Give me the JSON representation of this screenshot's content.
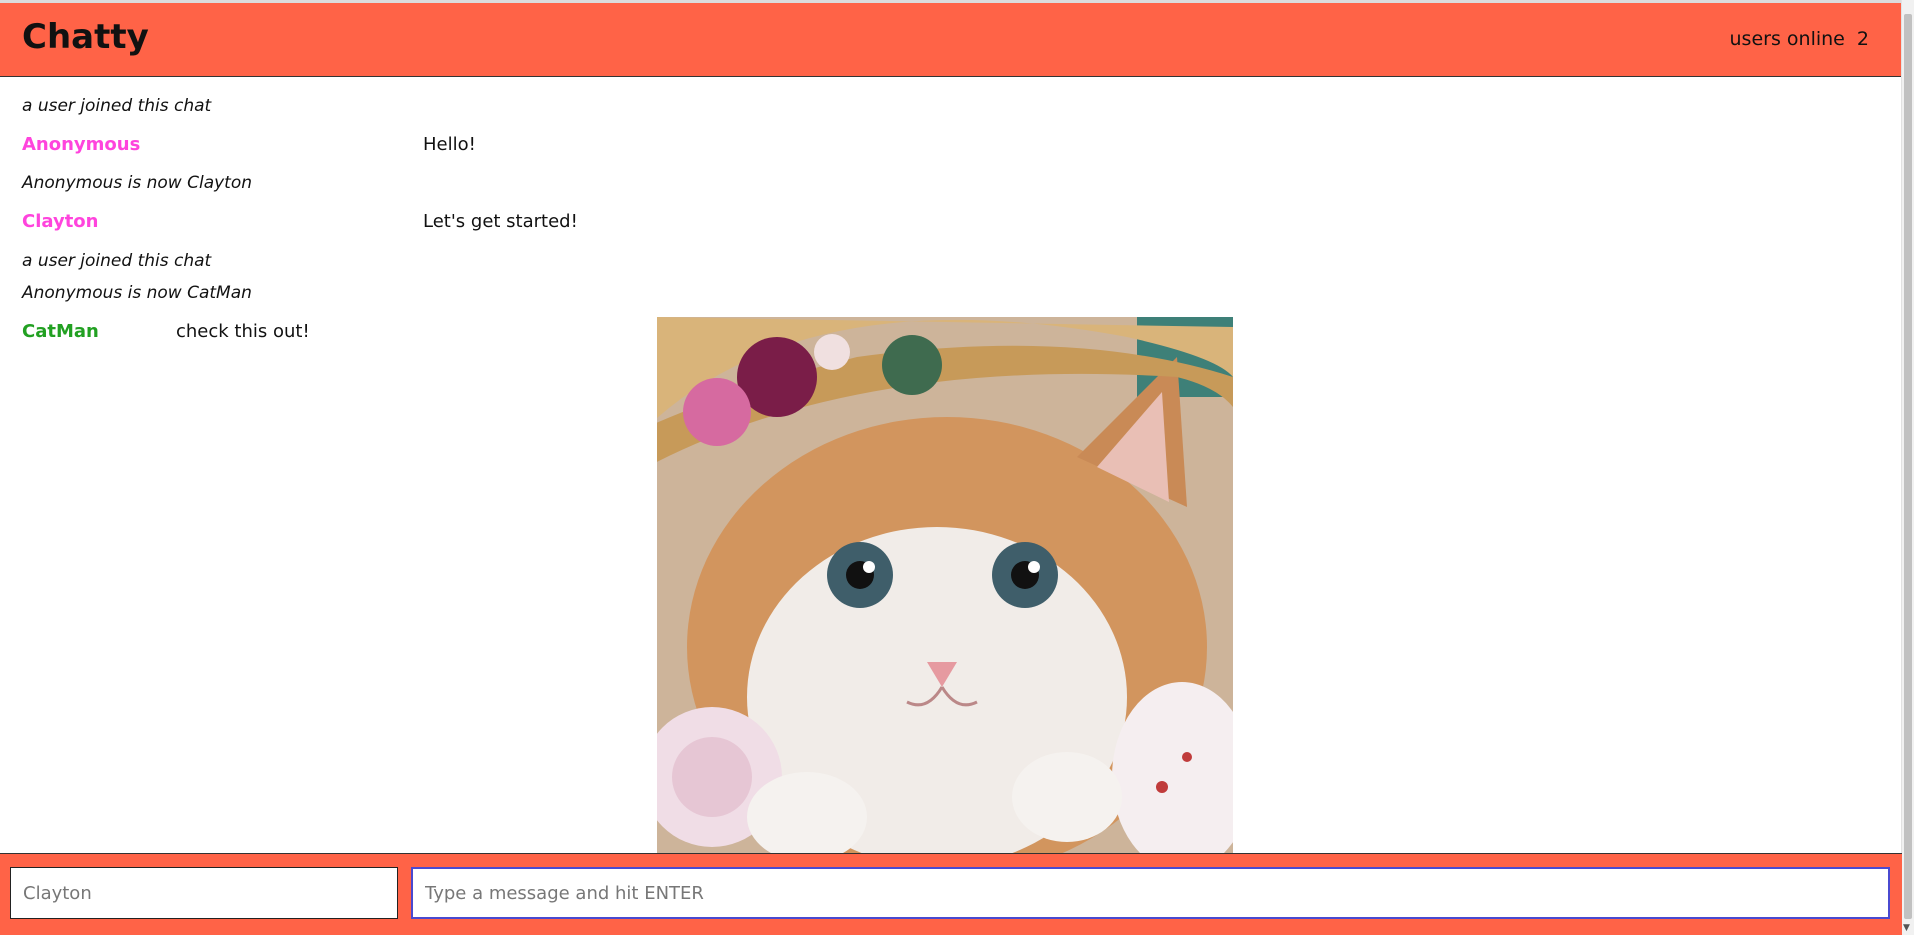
{
  "header": {
    "title": "Chatty",
    "users_online_label": "users online",
    "users_online_count": "2"
  },
  "messages": [
    {
      "type": "system",
      "text": "a user joined this chat"
    },
    {
      "type": "message",
      "username": "Anonymous",
      "username_color": "#ff44dd",
      "text": "Hello!"
    },
    {
      "type": "system",
      "text": "Anonymous is now Clayton"
    },
    {
      "type": "message",
      "username": "Clayton",
      "username_color": "#ff44dd",
      "text": "Let's get started!"
    },
    {
      "type": "system",
      "text": "a user joined this chat"
    },
    {
      "type": "system",
      "text": "Anonymous is now CatMan"
    },
    {
      "type": "message",
      "username": "CatMan",
      "username_color": "#22a022",
      "text": "check this out!",
      "image": "kitten-in-straw-hat-photo"
    }
  ],
  "chatbar": {
    "username_placeholder": "Clayton",
    "message_placeholder": "Type a message and hit ENTER"
  },
  "colors": {
    "accent": "#ff6347",
    "user_pink": "#ff44dd",
    "user_green": "#22a022"
  }
}
